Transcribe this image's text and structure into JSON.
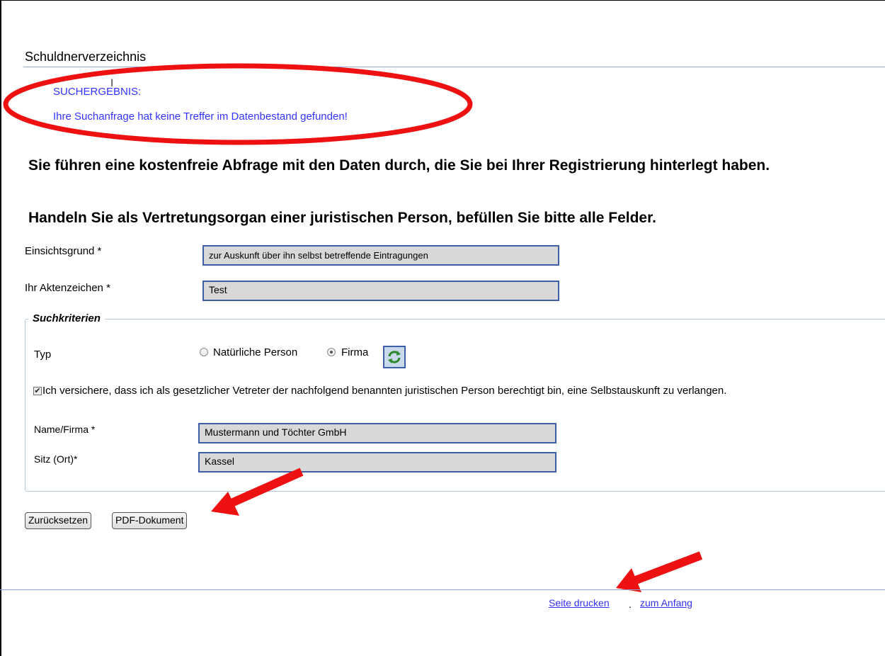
{
  "page": {
    "title": "Schuldnerverzeichnis"
  },
  "result": {
    "heading": "SUCHERGEBNIS:",
    "message": "Ihre Suchanfrage hat keine Treffer im Datenbestand gefunden!"
  },
  "info": {
    "line1": "Sie führen eine kostenfreie Abfrage mit den Daten durch, die Sie bei Ihrer Registrierung hinterlegt haben.",
    "line2": "Handeln Sie als Vertretungsorgan einer juristischen Person, befüllen Sie bitte alle Felder."
  },
  "form": {
    "einsichtsgrund_label": "Einsichtsgrund *",
    "einsichtsgrund_value": "zur Auskunft über ihn selbst betreffende Eintragungen",
    "aktenzeichen_label": "Ihr Aktenzeichen *",
    "aktenzeichen_value": "Test"
  },
  "suchkriterien": {
    "legend": "Suchkriterien",
    "typ_label": "Typ",
    "option_natuerlich": "Natürliche Person",
    "option_firma": "Firma",
    "selected": "Firma",
    "refresh_icon": "refresh-icon",
    "consent_checked": true,
    "consent_text": "Ich versichere, dass ich als gesetzlicher Vetreter der nachfolgend benannten juristischen Person berechtigt bin, eine Selbstauskunft zu verlangen.",
    "name_label": "Name/Firma *",
    "name_value": "Mustermann und Töchter GmbH",
    "sitz_label": "Sitz (Ort)*",
    "sitz_value": "Kassel"
  },
  "buttons": {
    "reset": "Zurücksetzen",
    "pdf": "PDF-Dokument"
  },
  "footer": {
    "print_link": "Seite drucken",
    "separator": ".",
    "top_link": "zum Anfang"
  },
  "annotation": {
    "color": "#ee1111"
  }
}
